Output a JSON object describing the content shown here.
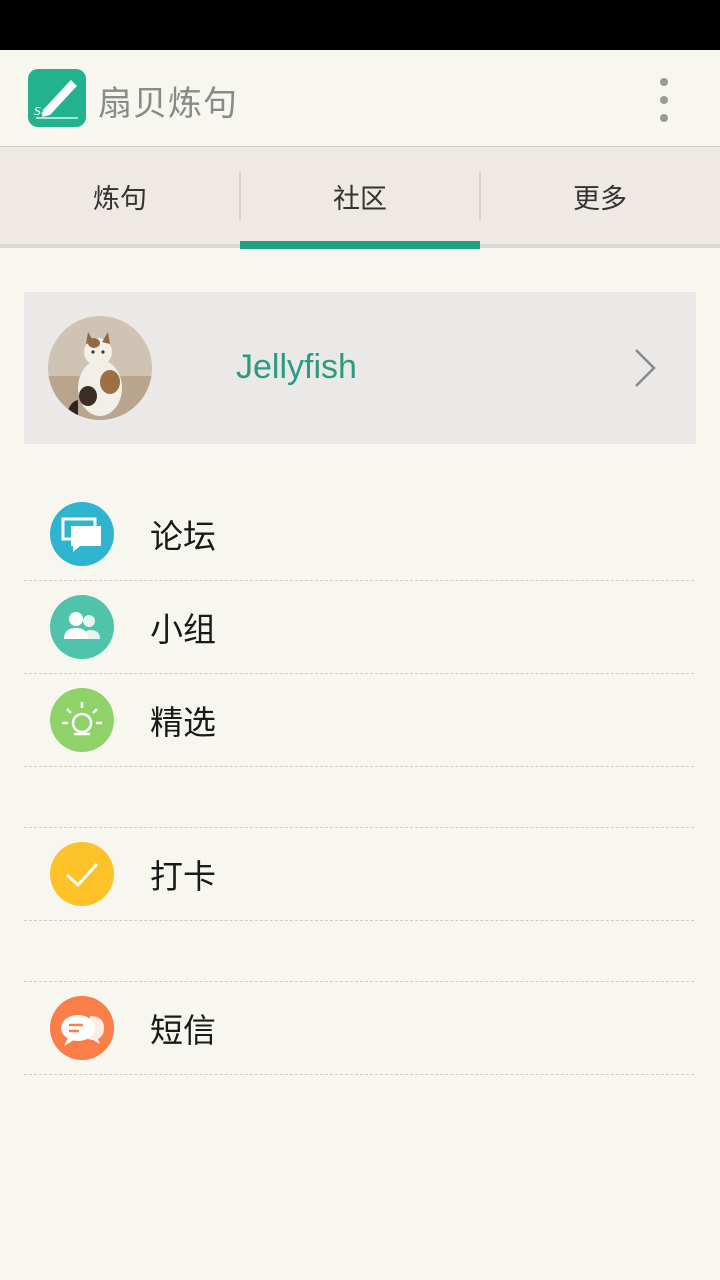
{
  "app": {
    "title": "扇贝炼句"
  },
  "tabs": {
    "items": [
      {
        "label": "炼句"
      },
      {
        "label": "社区"
      },
      {
        "label": "更多"
      }
    ],
    "active_index": 1
  },
  "profile": {
    "username": "Jellyfish"
  },
  "menu": {
    "forum": {
      "label": "论坛",
      "icon": "forum-icon",
      "color": "#2fb4cf"
    },
    "groups": {
      "label": "小组",
      "icon": "group-icon",
      "color": "#4fc4aa"
    },
    "featured": {
      "label": "精选",
      "icon": "bulb-icon",
      "color": "#8fd26a"
    },
    "checkin": {
      "label": "打卡",
      "icon": "check-icon",
      "color": "#fdc227"
    },
    "messages": {
      "label": "短信",
      "icon": "message-icon",
      "color": "#fb7d48"
    }
  },
  "colors": {
    "accent": "#23a084",
    "background": "#f7f6ef"
  }
}
